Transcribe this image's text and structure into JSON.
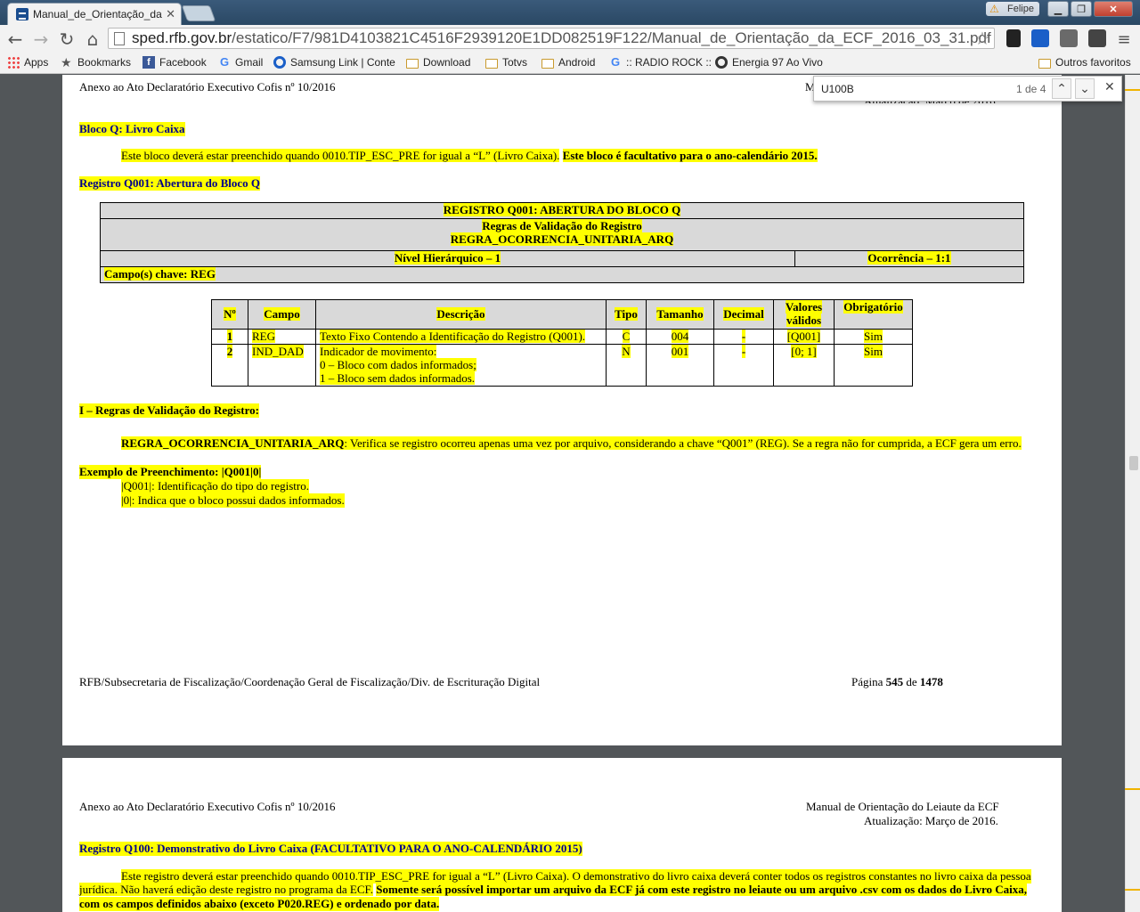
{
  "browser": {
    "tab_title": "Manual_de_Orientação_da",
    "user_name": "Felipe",
    "url_domain": "sped.rfb.gov.br",
    "url_path": "/estatico/F7/981D4103821C4516F2939120E1DD082519F122/Manual_de_Orientação_da_ECF_2016_03_31.pdf",
    "bookmarks": [
      "Apps",
      "Bookmarks",
      "Facebook",
      "Gmail",
      "Samsung Link | Conte",
      "Download",
      "Totvs",
      "Android",
      ":: RADIO ROCK ::",
      "Energia 97 Ao Vivo"
    ],
    "other_bookmarks": "Outros favoritos"
  },
  "find": {
    "query": "U100B",
    "count": "1 de 4"
  },
  "page1": {
    "header_left": "Anexo ao Ato Declaratório Executivo Cofis nº  10/2016",
    "header_right_partial": "M",
    "header_right_line2": "Atualização: Março de 2016.",
    "bloco_q_title": "Bloco Q: Livro Caixa",
    "bloco_q_text1": "Este bloco deverá estar preenchido quando 0010.TIP_ESC_PRE for igual a “L” (Livro Caixa).",
    "bloco_q_text2": "Este bloco é facultativo para o ano-calendário 2015.",
    "q001_title": "Registro Q001: Abertura do Bloco Q",
    "header_table": {
      "title": "REGISTRO Q001: ABERTURA DO BLOCO Q",
      "rules_1": "Regras de Validação do Registro",
      "rules_2": "REGRA_OCORRENCIA_UNITARIA_ARQ",
      "nivel": "Nível Hierárquico – 1",
      "ocorrencia": "Ocorrência – 1:1",
      "chave": "Campo(s) chave: REG"
    },
    "fields": {
      "headers": [
        "Nº",
        "Campo",
        "Descrição",
        "Tipo",
        "Tamanho",
        "Decimal",
        "Valores válidos",
        "Obrigatório"
      ],
      "rows": [
        {
          "n": "1",
          "campo": "REG",
          "descricao": "Texto Fixo Contendo a Identificação do Registro (Q001).",
          "tipo": "C",
          "tamanho": "004",
          "decimal": "-",
          "valores": "[Q001]",
          "obrig": "Sim"
        },
        {
          "n": "2",
          "campo": "IND_DAD",
          "descricao": "Indicador de movimento:",
          "desc2": "0 – Bloco com dados informados;",
          "desc3": "1 – Bloco sem dados informados.",
          "tipo": "N",
          "tamanho": "001",
          "decimal": "-",
          "valores": "[0; 1]",
          "obrig": "Sim"
        }
      ]
    },
    "rules_title": "I – Regras de Validação do Registro:",
    "rule_name": "REGRA_OCORRENCIA_UNITARIA_ARQ",
    "rule_text": ": Verifica se registro ocorreu apenas uma vez por arquivo, considerando a chave “Q001” (REG). Se a regra não for cumprida, a ECF gera um erro.",
    "example_title": "Exemplo de Preenchimento: |Q001|0|",
    "example_1": "|Q001|: Identificação do tipo do registro.",
    "example_2": "|0|: Indica que o bloco possui dados informados.",
    "footer_left": "RFB/Subsecretaria de Fiscalização/Coordenação Geral de Fiscalização/Div. de Escrituração Digital",
    "footer_pagina": "Página",
    "footer_num": "545",
    "footer_de": "de",
    "footer_total": "1478"
  },
  "page2": {
    "header_left": "Anexo ao Ato Declaratório Executivo Cofis nº  10/2016",
    "header_right_1": "Manual de Orientação do Leiaute da ECF",
    "header_right_2": "Atualização: Março de 2016.",
    "q100_title": "Registro Q100: Demonstrativo do Livro Caixa (FACULTATIVO PARA O ANO-CALENDÁRIO 2015)",
    "q100_line1": "Este registro deverá estar preenchido quando 0010.TIP_ESC_PRE for igual a “L” (Livro Caixa). O demonstrativo do livro caixa deverá conter todos os registros constantes no livro caixa da pessoa",
    "q100_line2a": "jurídica. Não haverá edição deste registro no programa da ECF.",
    "q100_line2b": "Somente será possível importar um arquivo da ECF já com este registro no leiaute ou um arquivo .csv com os dados do Livro Caixa,",
    "q100_line3": "com os campos definidos abaixo (exceto P020.REG) e ordenado por data."
  }
}
